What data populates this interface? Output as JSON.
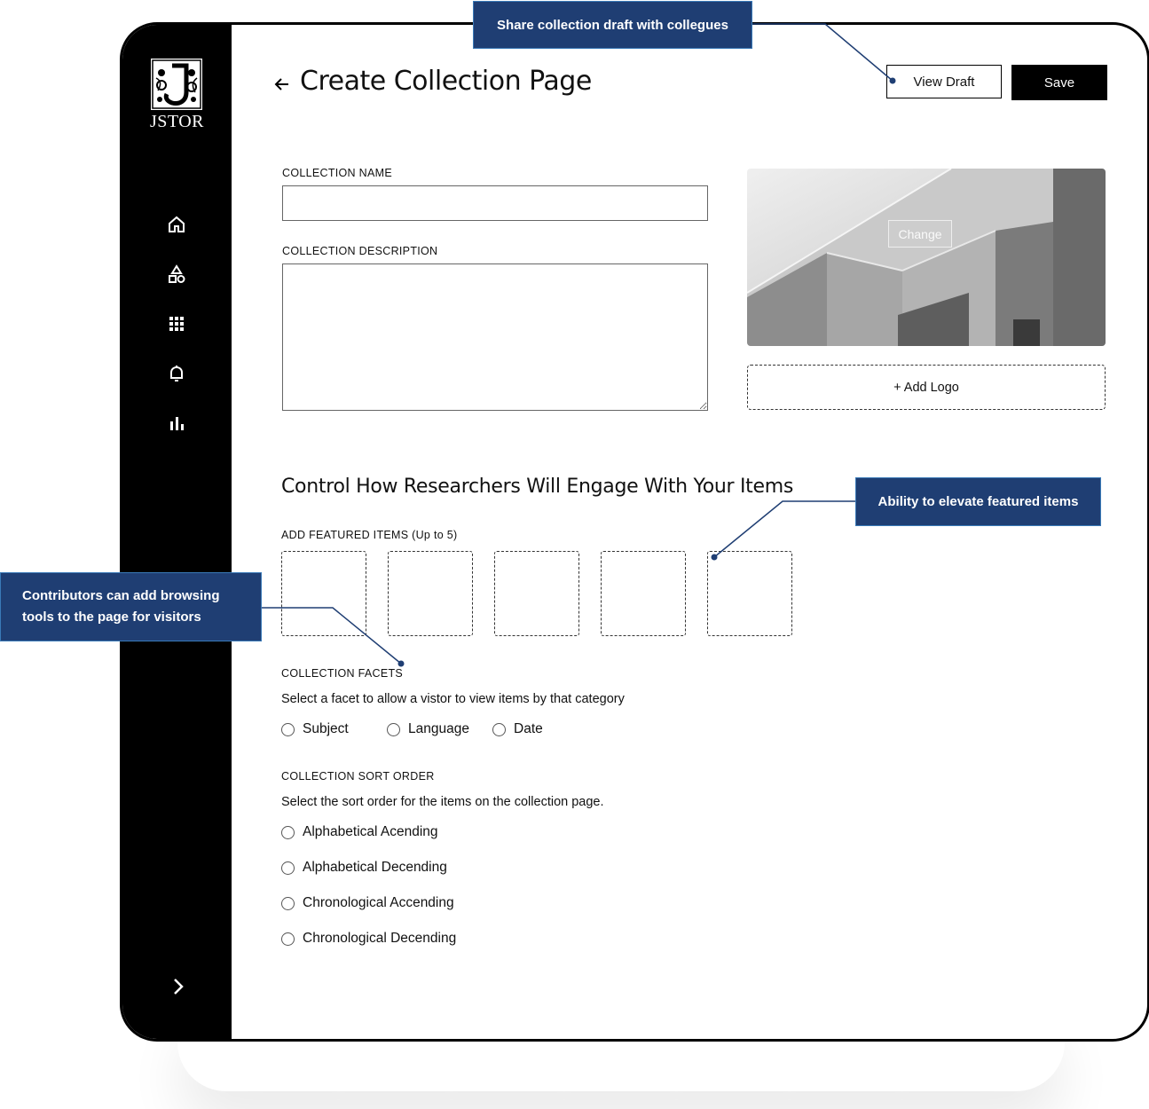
{
  "app": {
    "logo_text": "JSTOR"
  },
  "sidebar": {
    "items": [
      {
        "icon": "home-icon"
      },
      {
        "icon": "shapes-icon"
      },
      {
        "icon": "grid-icon"
      },
      {
        "icon": "bell-icon"
      },
      {
        "icon": "bar-chart-icon"
      }
    ],
    "expand_icon": "chevron-right-icon"
  },
  "header": {
    "title": "Create Collection Page",
    "view_draft_label": "View Draft",
    "save_label": "Save"
  },
  "form": {
    "name_label": "COLLECTION NAME",
    "name_value": "",
    "description_label": "COLLECTION DESCRIPTION",
    "description_value": "",
    "change_label": "Change",
    "add_logo_label": "+ Add Logo"
  },
  "engage": {
    "title": "Control How Researchers Will Engage With Your Items",
    "featured_label": "ADD FEATURED ITEMS (Up to 5)",
    "facets_label": "COLLECTION FACETS",
    "facets_desc": "Select a facet to allow a vistor to view items by that category",
    "facets": [
      "Subject",
      "Language",
      "Date"
    ],
    "sort_label": "COLLECTION SORT ORDER",
    "sort_desc": "Select the sort order for  the items on the collection page.",
    "sort_options": [
      "Alphabetical Acending",
      "Alphabetical Decending",
      "Chronological Accending",
      "Chronological Decending"
    ]
  },
  "callouts": {
    "share": "Share collection draft with collegues",
    "featured": "Ability to elevate featured items",
    "facets_line1": "Contributors can add browsing",
    "facets_line2": "tools to the page for visitors"
  },
  "colors": {
    "callout_bg": "#1f3e73",
    "callout_border": "#3a7ab8",
    "sidebar": "#000000"
  }
}
